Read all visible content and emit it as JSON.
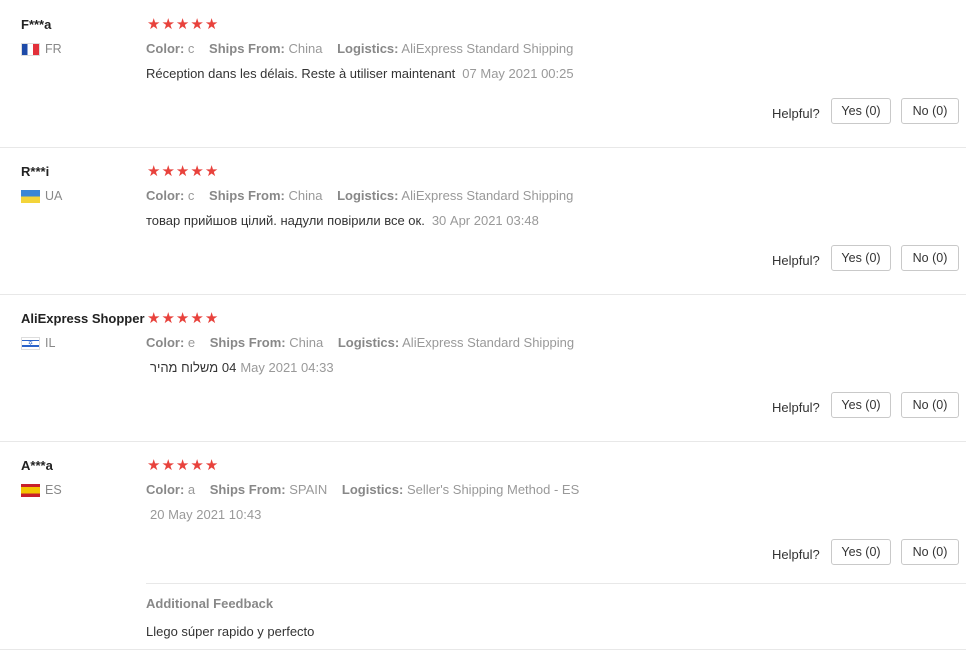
{
  "labels": {
    "color": "Color:",
    "ships_from": "Ships From:",
    "logistics": "Logistics:",
    "helpful": "Helpful?",
    "star": "★",
    "additional_feedback": "Additional Feedback"
  },
  "colors": {
    "star": "#e8423c",
    "muted": "#999999",
    "border": "#c9c9c9"
  },
  "reviews": [
    {
      "user": "F***a",
      "country": "FR",
      "flag_icon": "flag-fr-icon",
      "rating": 5,
      "color": "c",
      "ships_from": "China",
      "logistics": "AliExpress Standard Shipping",
      "comment": "Réception dans les délais. Reste à utiliser maintenant",
      "date": "07 May 2021 00:25",
      "yes": "Yes (0)",
      "no": "No (0)"
    },
    {
      "user": "R***i",
      "country": "UA",
      "flag_icon": "flag-ua-icon",
      "rating": 5,
      "color": "c",
      "ships_from": "China",
      "logistics": "AliExpress Standard Shipping",
      "comment": "товар прийшов цілий. надули повірили все ок.",
      "date": "30 Apr 2021 03:48",
      "yes": "Yes (0)",
      "no": "No (0)"
    },
    {
      "user": "AliExpress Shopper",
      "country": "IL",
      "flag_icon": "flag-il-icon",
      "rating": 5,
      "color": "e",
      "ships_from": "China",
      "logistics": "AliExpress Standard Shipping",
      "comment": "04 משלוח מהיר",
      "date": "May 2021 04:33",
      "yes": "Yes (0)",
      "no": "No (0)"
    },
    {
      "user": "A***a",
      "country": "ES",
      "flag_icon": "flag-es-icon",
      "rating": 5,
      "color": "a",
      "ships_from": "SPAIN",
      "logistics": "Seller's Shipping Method - ES",
      "comment": "",
      "date": "20 May 2021 10:43",
      "yes": "Yes (0)",
      "no": "No (0)",
      "additional_feedback": "Llego súper rapido y perfecto"
    }
  ]
}
